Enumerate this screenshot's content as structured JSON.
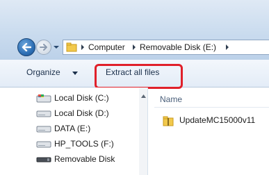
{
  "address": {
    "segments": [
      "Computer",
      "Removable Disk (E:)"
    ]
  },
  "toolbar": {
    "organize_label": "Organize",
    "extract_label": "Extract all files"
  },
  "nav_pane": {
    "items": [
      {
        "label": "Local Disk (C:)",
        "icon": "system-drive-icon"
      },
      {
        "label": "Local Disk (D:)",
        "icon": "drive-icon"
      },
      {
        "label": "DATA (E:)",
        "icon": "drive-icon"
      },
      {
        "label": "HP_TOOLS (F:)",
        "icon": "drive-icon"
      },
      {
        "label": "Removable Disk",
        "icon": "removable-drive-icon"
      }
    ]
  },
  "content": {
    "column_name": "Name",
    "files": [
      {
        "name": "UpdateMC15000v11",
        "icon": "zip-folder-icon"
      }
    ]
  },
  "colors": {
    "highlight": "#e0202a",
    "toolbar_bg": "#eaf1f9",
    "titlebar_bg": "#c9dbee"
  }
}
